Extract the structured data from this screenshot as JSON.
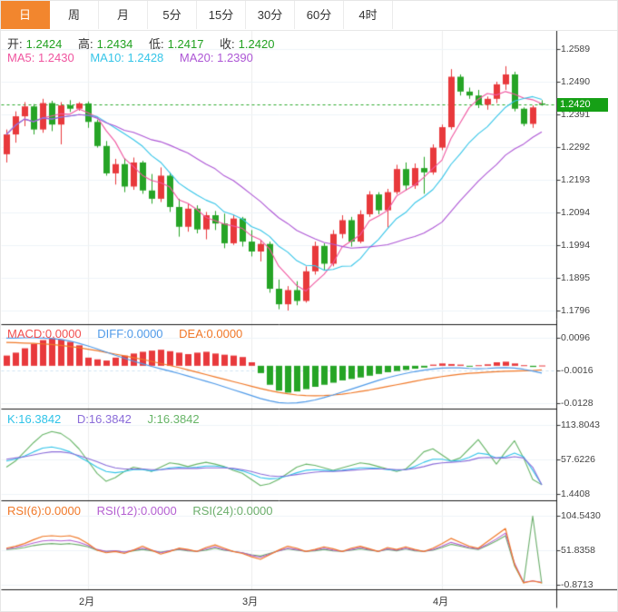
{
  "tabs": [
    {
      "label": "日",
      "active": true
    },
    {
      "label": "周",
      "active": false
    },
    {
      "label": "月",
      "active": false
    },
    {
      "label": "5分",
      "active": false
    },
    {
      "label": "15分",
      "active": false
    },
    {
      "label": "30分",
      "active": false
    },
    {
      "label": "60分",
      "active": false
    },
    {
      "label": "4时",
      "active": false
    }
  ],
  "colors": {
    "up": "#e8393c",
    "down": "#26a426",
    "ma5": "#f0559f",
    "ma10": "#35c5e8",
    "ma20": "#ad56d5",
    "macd_label": "#f25050",
    "diff": "#4f9ae8",
    "dea": "#f07828",
    "k": "#2fc3e8",
    "d": "#8a6cd9",
    "j": "#67b567",
    "rsi6": "#f07828",
    "rsi12": "#b45fd1",
    "rsi24": "#6cae6c",
    "tab_active_bg": "#f2862e",
    "badge_bg": "#16a016",
    "price_line": "#2aa82a"
  },
  "legend": {
    "ohlc": [
      {
        "label": "开:",
        "value": "1.2424"
      },
      {
        "label": "高:",
        "value": "1.2434"
      },
      {
        "label": "低:",
        "value": "1.2417"
      },
      {
        "label": "收:",
        "value": "1.2420"
      }
    ],
    "ma": [
      {
        "text": "MA5: 1.2430"
      },
      {
        "text": "MA10: 1.2428"
      },
      {
        "text": "MA20: 1.2390"
      }
    ],
    "macd": [
      {
        "text": "MACD:0.0000"
      },
      {
        "text": "DIFF:0.0000"
      },
      {
        "text": "DEA:0.0000"
      }
    ],
    "kdj": [
      {
        "text": "K:16.3842"
      },
      {
        "text": "D:16.3842"
      },
      {
        "text": "J:16.3842"
      }
    ],
    "rsi": [
      {
        "text": "RSI(6):0.0000"
      },
      {
        "text": "RSI(12):0.0000"
      },
      {
        "text": "RSI(24):0.0000"
      }
    ]
  },
  "axis": {
    "price_ticks": [
      "1.2589",
      "1.2490",
      "1.2391",
      "1.2292",
      "1.2193",
      "1.2094",
      "1.1994",
      "1.1895",
      "1.1796"
    ],
    "current_price": "1.2420",
    "macd_ticks": [
      "0.0096",
      "-0.0016",
      "-0.0128"
    ],
    "kdj_ticks": [
      "113.8043",
      "57.6226",
      "1.4408"
    ],
    "rsi_ticks": [
      "104.5430",
      "51.8358",
      "-0.8713"
    ],
    "months": [
      "2月",
      "3月",
      "4月"
    ]
  },
  "chart_data": [
    {
      "type": "candlestick",
      "title": "日K main panel, OHLC candles with MA5/MA10/MA20 overlays",
      "ylim": [
        1.1796,
        1.2589
      ],
      "current_price": 1.242,
      "month_tick_indices": [
        9,
        27,
        48
      ],
      "month_labels": [
        "2月",
        "3月",
        "4月"
      ],
      "candles": [
        [
          1.227,
          1.2345,
          1.2245,
          1.233
        ],
        [
          1.233,
          1.24,
          1.2305,
          1.2385
        ],
        [
          1.2385,
          1.2428,
          1.2355,
          1.2415
        ],
        [
          1.2415,
          1.2422,
          1.233,
          1.2345
        ],
        [
          1.2345,
          1.2438,
          1.2335,
          1.2425
        ],
        [
          1.2425,
          1.2432,
          1.234,
          1.236
        ],
        [
          1.236,
          1.2428,
          1.23,
          1.2418
        ],
        [
          1.2418,
          1.2434,
          1.2398,
          1.2408
        ],
        [
          1.2408,
          1.2428,
          1.2402,
          1.2424
        ],
        [
          1.2424,
          1.243,
          1.235,
          1.2368
        ],
        [
          1.2368,
          1.2375,
          1.229,
          1.2295
        ],
        [
          1.2295,
          1.231,
          1.2205,
          1.2212
        ],
        [
          1.2212,
          1.2256,
          1.2178,
          1.224
        ],
        [
          1.224,
          1.2258,
          1.2155,
          1.2172
        ],
        [
          1.2172,
          1.226,
          1.2162,
          1.2245
        ],
        [
          1.2245,
          1.225,
          1.215,
          1.216
        ],
        [
          1.216,
          1.221,
          1.212,
          1.2135
        ],
        [
          1.2135,
          1.223,
          1.2125,
          1.2205
        ],
        [
          1.2205,
          1.2215,
          1.2095,
          1.211
        ],
        [
          1.211,
          1.2135,
          1.202,
          1.205
        ],
        [
          1.205,
          1.212,
          1.2035,
          1.2105
        ],
        [
          1.2105,
          1.2115,
          1.203,
          1.2042
        ],
        [
          1.2042,
          1.2095,
          1.2012,
          1.2085
        ],
        [
          1.2085,
          1.2098,
          1.204,
          1.206
        ],
        [
          1.206,
          1.209,
          1.1985,
          1.2
        ],
        [
          1.2,
          1.2085,
          1.1995,
          1.2075
        ],
        [
          1.2075,
          1.208,
          1.199,
          1.2005
        ],
        [
          1.2005,
          1.204,
          1.196,
          1.1975
        ],
        [
          1.1975,
          1.201,
          1.1945,
          1.1998
        ],
        [
          1.1998,
          1.2005,
          1.185,
          1.1862
        ],
        [
          1.1862,
          1.189,
          1.18,
          1.1815
        ],
        [
          1.1815,
          1.187,
          1.1796,
          1.1858
        ],
        [
          1.1858,
          1.1885,
          1.1812,
          1.1825
        ],
        [
          1.1825,
          1.193,
          1.182,
          1.1915
        ],
        [
          1.1915,
          1.2005,
          1.1905,
          1.1992
        ],
        [
          1.1992,
          1.2,
          1.192,
          1.1938
        ],
        [
          1.1938,
          1.204,
          1.193,
          1.2028
        ],
        [
          1.2028,
          1.2085,
          1.2015,
          1.207
        ],
        [
          1.207,
          1.208,
          1.199,
          1.2005
        ],
        [
          1.2005,
          1.21,
          1.2,
          1.2088
        ],
        [
          1.2088,
          1.2158,
          1.208,
          1.2148
        ],
        [
          1.2148,
          1.2155,
          1.2088,
          1.21
        ],
        [
          1.21,
          1.2165,
          1.2048,
          1.2155
        ],
        [
          1.2155,
          1.2238,
          1.2148,
          1.2225
        ],
        [
          1.2225,
          1.2245,
          1.216,
          1.2175
        ],
        [
          1.2175,
          1.2242,
          1.2165,
          1.2228
        ],
        [
          1.2228,
          1.2262,
          1.215,
          1.2215
        ],
        [
          1.2215,
          1.23,
          1.2208,
          1.229
        ],
        [
          1.229,
          1.236,
          1.2282,
          1.2352
        ],
        [
          1.2352,
          1.2528,
          1.2345,
          1.2505
        ],
        [
          1.2505,
          1.2512,
          1.2448,
          1.246
        ],
        [
          1.246,
          1.2472,
          1.2438,
          1.2448
        ],
        [
          1.2448,
          1.2465,
          1.241,
          1.242
        ],
        [
          1.242,
          1.2445,
          1.2405,
          1.2438
        ],
        [
          1.2438,
          1.249,
          1.2425,
          1.2482
        ],
        [
          1.2482,
          1.2537,
          1.2465,
          1.2512
        ],
        [
          1.2512,
          1.252,
          1.24,
          1.2408
        ],
        [
          1.2408,
          1.2412,
          1.2355,
          1.2362
        ],
        [
          1.2362,
          1.2418,
          1.235,
          1.2412
        ],
        [
          1.2424,
          1.2434,
          1.2417,
          1.242
        ]
      ]
    },
    {
      "type": "bar",
      "title": "MACD panel: histogram + DIFF/DEA lines",
      "ylim": [
        -0.0128,
        0.0096
      ],
      "histogram": [
        0.0035,
        0.0045,
        0.006,
        0.0075,
        0.0088,
        0.0095,
        0.009,
        0.0082,
        0.007,
        0.0028,
        0.0022,
        0.0018,
        0.0028,
        0.0035,
        0.0042,
        0.0048,
        0.0052,
        0.0055,
        0.005,
        0.0045,
        0.004,
        0.0045,
        0.0048,
        0.0042,
        0.0038,
        0.0035,
        0.003,
        0.0012,
        -0.0025,
        -0.0065,
        -0.0085,
        -0.0092,
        -0.0088,
        -0.008,
        -0.0072,
        -0.0065,
        -0.0058,
        -0.005,
        -0.0045,
        -0.004,
        -0.0034,
        -0.0028,
        -0.0022,
        -0.0018,
        -0.0014,
        -0.001,
        -0.0006,
        0.0004,
        0.0008,
        0.0006,
        0.0004,
        -0.0003,
        0.0002,
        0.0005,
        0.0012,
        0.0014,
        0.0008,
        0.0002,
        -0.0004,
        0.0001
      ],
      "diff": [
        0.0095,
        0.0095,
        0.0096,
        0.0096,
        0.0095,
        0.0093,
        0.009,
        0.0085,
        0.0077,
        0.0068,
        0.0058,
        0.0047,
        0.0036,
        0.0026,
        0.0016,
        0.0007,
        -0.0002,
        -0.001,
        -0.0018,
        -0.0026,
        -0.0035,
        -0.0044,
        -0.0053,
        -0.0062,
        -0.0072,
        -0.0082,
        -0.0092,
        -0.0102,
        -0.0112,
        -0.012,
        -0.0126,
        -0.0128,
        -0.0127,
        -0.0123,
        -0.0117,
        -0.0109,
        -0.01,
        -0.009,
        -0.008,
        -0.007,
        -0.006,
        -0.005,
        -0.0041,
        -0.0033,
        -0.0026,
        -0.002,
        -0.0015,
        -0.0011,
        -0.0008,
        -0.0007,
        -0.0007,
        -0.0009,
        -0.001,
        -0.0009,
        -0.0007,
        -0.0006,
        -0.0008,
        -0.0012,
        -0.0018,
        -0.0025
      ],
      "dea": [
        0.008,
        0.0079,
        0.0078,
        0.0077,
        0.0075,
        0.0073,
        0.007,
        0.0066,
        0.0062,
        0.0057,
        0.0052,
        0.0046,
        0.004,
        0.0034,
        0.0028,
        0.0022,
        0.0015,
        0.0008,
        0.0001,
        -0.0006,
        -0.0014,
        -0.0022,
        -0.003,
        -0.0038,
        -0.0046,
        -0.0054,
        -0.0062,
        -0.007,
        -0.0078,
        -0.0085,
        -0.0091,
        -0.0096,
        -0.01,
        -0.0102,
        -0.0103,
        -0.0102,
        -0.01,
        -0.0097,
        -0.0093,
        -0.0088,
        -0.0083,
        -0.0077,
        -0.0071,
        -0.0065,
        -0.0059,
        -0.0053,
        -0.0047,
        -0.0042,
        -0.0037,
        -0.0033,
        -0.0029,
        -0.0026,
        -0.0024,
        -0.0022,
        -0.002,
        -0.0019,
        -0.0018,
        -0.0017,
        -0.0016,
        -0.0014
      ]
    },
    {
      "type": "line",
      "title": "KDJ panel",
      "ylim": [
        1.4408,
        113.8043
      ],
      "k": [
        55,
        58,
        63,
        70,
        76,
        78,
        75,
        70,
        62,
        54,
        45,
        38,
        36,
        38,
        41,
        41,
        39,
        41,
        44,
        45,
        44,
        45,
        47,
        47,
        45,
        42,
        39,
        34,
        28,
        26,
        27,
        31,
        36,
        40,
        41,
        40,
        39,
        40,
        42,
        44,
        44,
        43,
        41,
        40,
        41,
        46,
        53,
        58,
        58,
        55,
        56,
        61,
        68,
        66,
        60,
        62,
        68,
        62,
        40,
        16.4
      ],
      "d": [
        58,
        60,
        62,
        65,
        68,
        70,
        70,
        68,
        64,
        59,
        54,
        48,
        44,
        42,
        42,
        42,
        41,
        41,
        42,
        43,
        43,
        43,
        44,
        44,
        44,
        43,
        41,
        38,
        34,
        31,
        30,
        31,
        33,
        35,
        37,
        38,
        38,
        39,
        40,
        41,
        42,
        42,
        42,
        41,
        41,
        43,
        46,
        50,
        52,
        53,
        54,
        56,
        60,
        61,
        60,
        60,
        62,
        60,
        45,
        16.4
      ],
      "j": [
        45,
        55,
        70,
        85,
        98,
        103,
        100,
        90,
        75,
        55,
        35,
        22,
        28,
        38,
        45,
        42,
        38,
        45,
        52,
        50,
        46,
        50,
        53,
        50,
        46,
        40,
        35,
        25,
        15,
        18,
        25,
        35,
        45,
        50,
        48,
        44,
        40,
        44,
        48,
        52,
        50,
        46,
        42,
        38,
        42,
        55,
        70,
        75,
        65,
        55,
        60,
        75,
        90,
        70,
        50,
        70,
        88,
        60,
        25,
        16.4
      ]
    },
    {
      "type": "line",
      "title": "RSI panel",
      "ylim": [
        -0.8713,
        104.543
      ],
      "rsi6": [
        55,
        58,
        62,
        68,
        73,
        74,
        73,
        74,
        70,
        62,
        52,
        48,
        50,
        47,
        52,
        58,
        52,
        46,
        50,
        55,
        53,
        50,
        56,
        60,
        55,
        50,
        47,
        42,
        38,
        45,
        52,
        58,
        55,
        50,
        53,
        57,
        54,
        50,
        55,
        58,
        54,
        50,
        56,
        53,
        57,
        53,
        50,
        55,
        62,
        70,
        64,
        58,
        55,
        65,
        75,
        85,
        30,
        2,
        5,
        2
      ],
      "rsi12": [
        54,
        56,
        59,
        63,
        66,
        67,
        66,
        67,
        64,
        59,
        53,
        50,
        51,
        49,
        52,
        55,
        52,
        48,
        51,
        54,
        52,
        50,
        54,
        57,
        53,
        50,
        48,
        44,
        41,
        46,
        51,
        55,
        53,
        50,
        52,
        55,
        52,
        50,
        53,
        56,
        53,
        50,
        54,
        52,
        55,
        52,
        50,
        53,
        58,
        64,
        60,
        56,
        54,
        61,
        69,
        78,
        32,
        3,
        5,
        3
      ],
      "rsi24": [
        53,
        54,
        56,
        59,
        61,
        62,
        61,
        62,
        60,
        57,
        52,
        50,
        51,
        49,
        51,
        53,
        51,
        49,
        51,
        53,
        51,
        50,
        52,
        55,
        52,
        50,
        48,
        45,
        43,
        47,
        51,
        54,
        52,
        50,
        51,
        53,
        51,
        50,
        52,
        54,
        52,
        50,
        53,
        51,
        54,
        51,
        50,
        52,
        56,
        61,
        58,
        55,
        53,
        59,
        66,
        74,
        28,
        2,
        104,
        1
      ]
    }
  ]
}
